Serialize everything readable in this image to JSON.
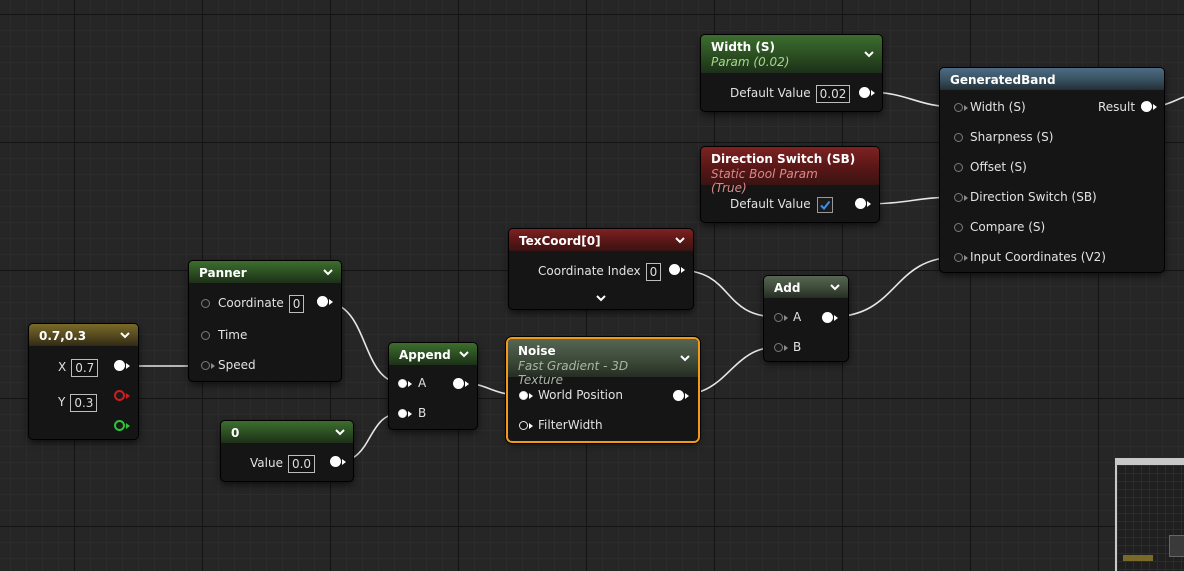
{
  "nodes": {
    "width_param": {
      "title": "Width (S)",
      "subtitle": "Param (0.02)",
      "row_label": "Default Value",
      "value": "0.02"
    },
    "direction_switch": {
      "title": "Direction Switch (SB)",
      "subtitle": "Static Bool Param (True)",
      "row_label": "Default Value",
      "checked": true
    },
    "generated_band": {
      "title": "GeneratedBand",
      "inputs": [
        "Width (S)",
        "Sharpness (S)",
        "Offset (S)",
        "Direction Switch (SB)",
        "Compare (S)",
        "Input Coordinates (V2)"
      ],
      "output": "Result"
    },
    "texcoord": {
      "title": "TexCoord[0]",
      "row_label": "Coordinate Index",
      "value": "0"
    },
    "add": {
      "title": "Add",
      "inputs": [
        "A",
        "B"
      ]
    },
    "panner": {
      "title": "Panner",
      "inputs": [
        "Coordinate",
        "Time",
        "Speed"
      ],
      "coordinate_value": "0"
    },
    "constant2": {
      "title": "0.7,0.3",
      "x_label": "X",
      "x_value": "0.7",
      "y_label": "Y",
      "y_value": "0.3"
    },
    "append": {
      "title": "Append",
      "inputs": [
        "A",
        "B"
      ]
    },
    "noise": {
      "title": "Noise",
      "subtitle": "Fast Gradient - 3D Texture",
      "inputs": [
        "World Position",
        "FilterWidth"
      ]
    },
    "constant": {
      "title": "0",
      "row_label": "Value",
      "value": "0.0"
    }
  },
  "colors": {
    "graph_background": "#262626",
    "parameter_header": "#3d6e2e",
    "static_bool_header": "#7e2222",
    "constant2_header": "#7a6a2a",
    "function_header": "#4d6b85",
    "selection_outline": "#ef9a1b",
    "wire": "#e6e6e6"
  },
  "icons": {
    "chevron": "chevron-down-icon",
    "checkmark": "checkmark-icon"
  }
}
